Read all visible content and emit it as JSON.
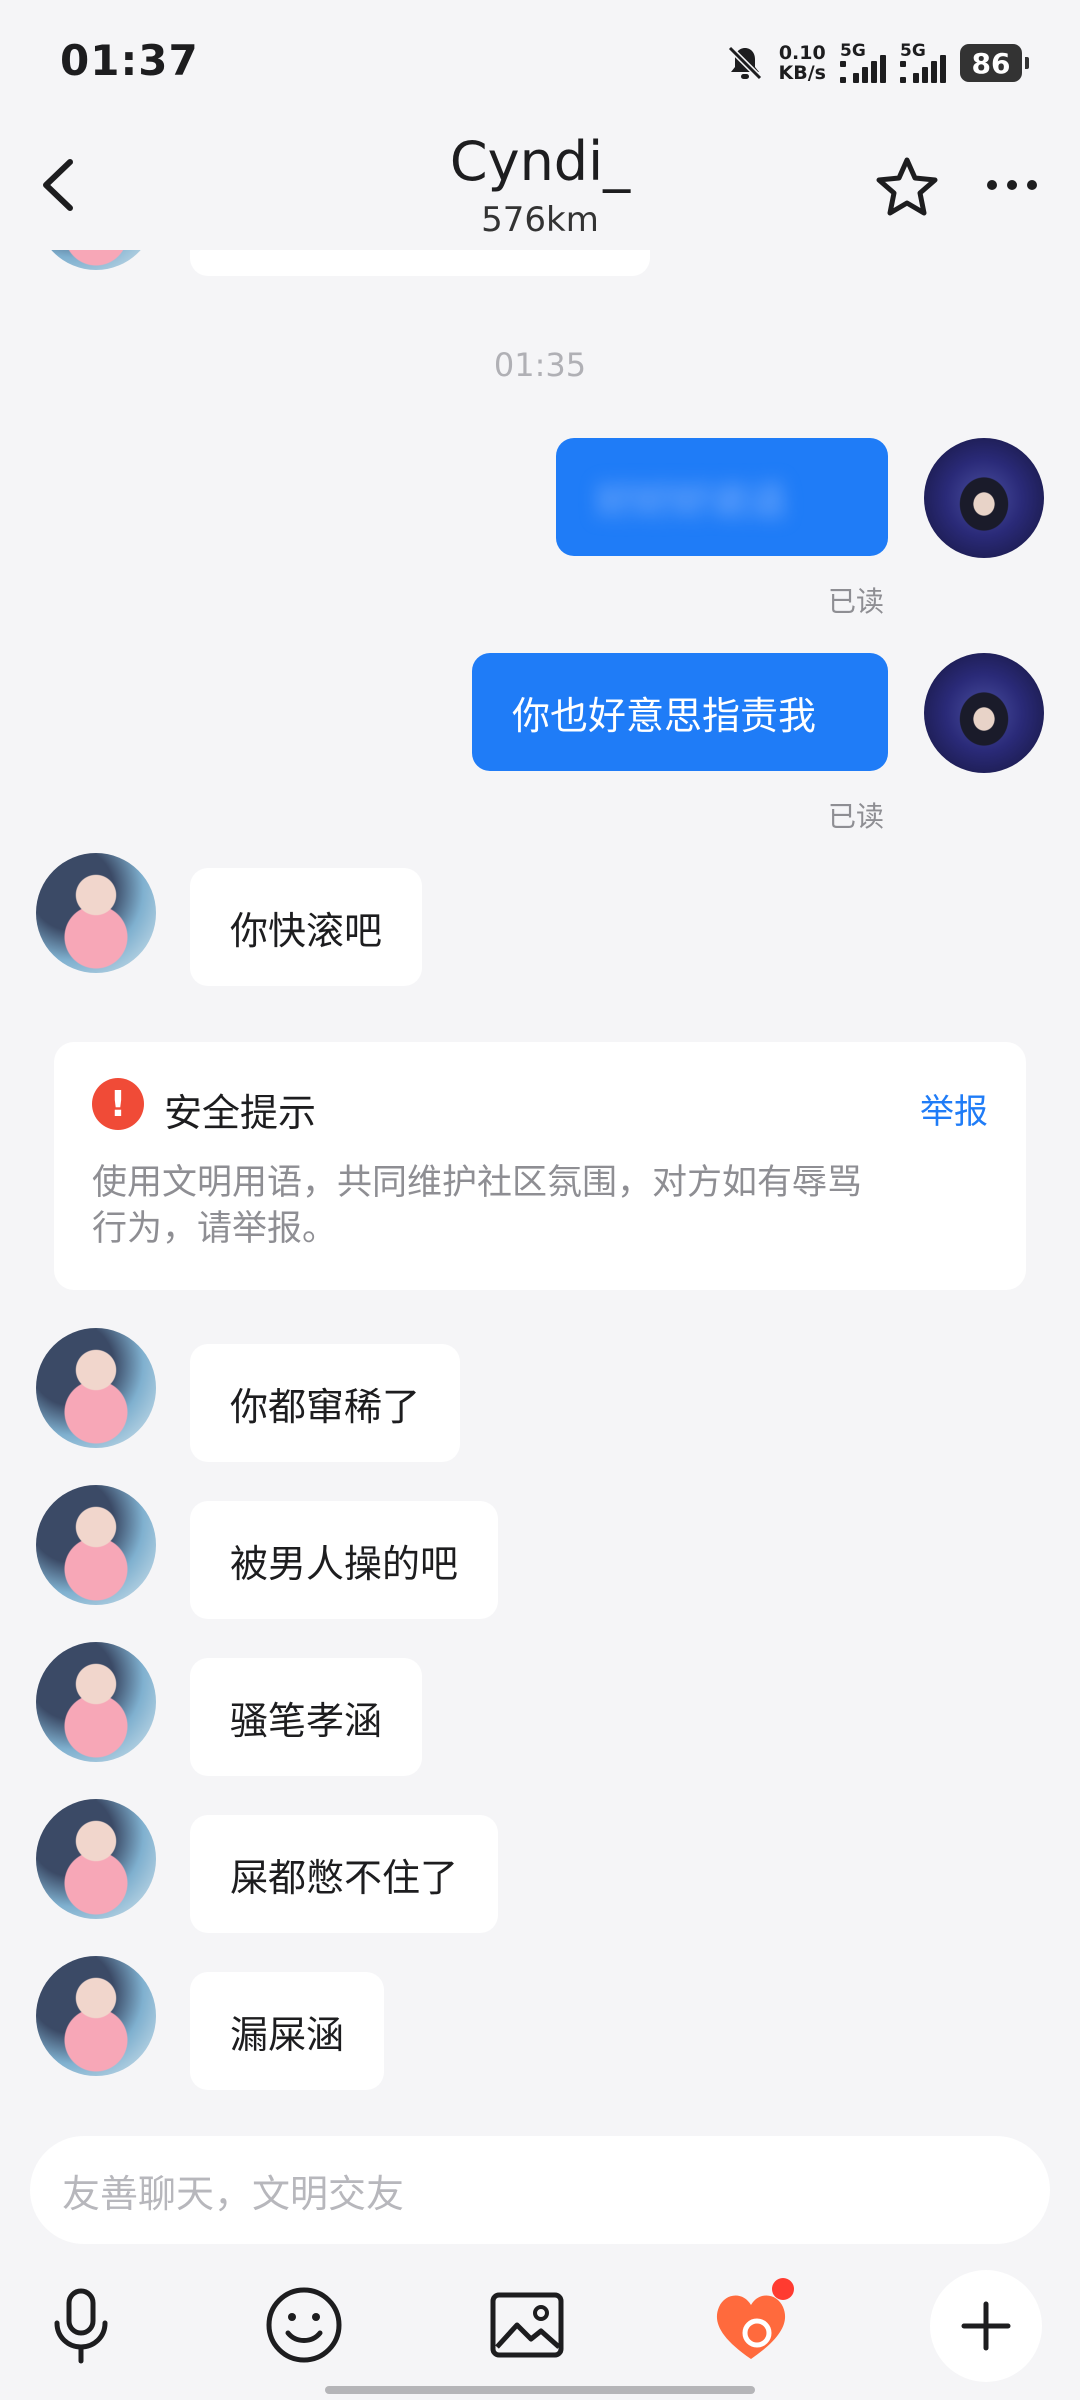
{
  "status_bar": {
    "time": "01:37",
    "speed_value": "0.10",
    "speed_unit": "KB/s",
    "net1": "5G",
    "net2": "5G",
    "battery": "86",
    "icons": [
      "bell-muted-icon",
      "signal-icon",
      "battery-icon"
    ]
  },
  "header": {
    "title": "Cyndi_",
    "distance": "576km",
    "icons": [
      "back-icon",
      "star-icon",
      "more-icon"
    ]
  },
  "messages": {
    "timestamp": "01:35",
    "out1_text": "好好好说话",
    "out1_read": "已读",
    "out2_text": "你也好意思指责我",
    "out2_read": "已读",
    "in1_text": "你快滚吧",
    "in2_text": "你都窜稀了",
    "in3_text": "被男人操的吧",
    "in4_text": "骚笔孝涵",
    "in5_text": "屎都憋不住了",
    "in6_text": "漏屎涵"
  },
  "safety_notice": {
    "icon": "!",
    "title": "安全提示",
    "report_label": "举报",
    "body_line1": "使用文明用语，共同维护社区氛围，对方如有辱骂",
    "body_line2": "行为，请举报。"
  },
  "input": {
    "placeholder": "友善聊天，文明交友"
  },
  "toolbar": {
    "icons": [
      "microphone-icon",
      "emoji-icon",
      "image-icon",
      "heart-gift-icon",
      "plus-icon"
    ]
  },
  "colors": {
    "accent": "#1f7cf7",
    "background": "#f5f5f7",
    "warning": "#f04b37"
  }
}
